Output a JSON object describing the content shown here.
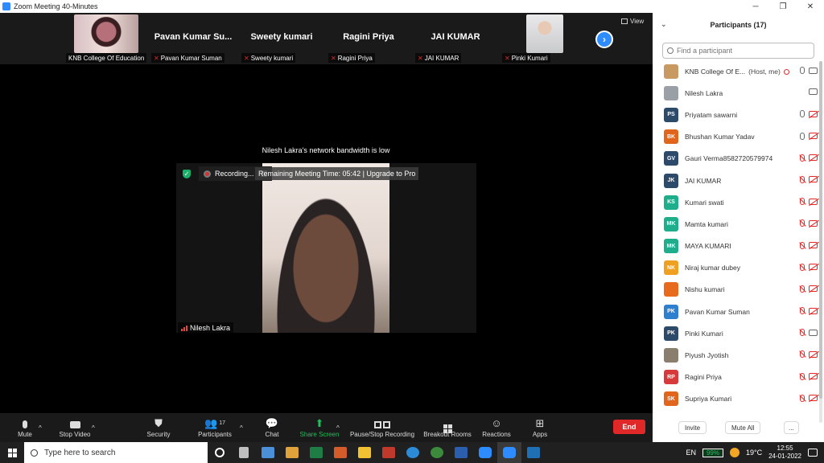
{
  "window": {
    "title": "Zoom Meeting 40-Minutes",
    "minimize": "─",
    "maximize": "❐",
    "close": "✕"
  },
  "thumbnails": [
    {
      "label": "KNB College Of Education",
      "big_name": "",
      "muted": false,
      "photo": "woman-red"
    },
    {
      "label": "Pavan Kumar Suman",
      "big_name": "Pavan Kumar Su...",
      "muted": true
    },
    {
      "label": "Sweety kumari",
      "big_name": "Sweety kumari",
      "muted": true
    },
    {
      "label": "Ragini  Priya",
      "big_name": "Ragini  Priya",
      "muted": true
    },
    {
      "label": "JAI KUMAR",
      "big_name": "JAI KUMAR",
      "muted": true
    },
    {
      "label": "Pinki Kumari",
      "big_name": "",
      "muted": true,
      "photo": "woman-white"
    }
  ],
  "view_label": "View",
  "next_arrow": "›",
  "bandwidth_notice": "Nilesh Lakra's network bandwidth is low",
  "active_video": {
    "recording_label": "Recording...",
    "remaining_text": "Remaining Meeting Time: 05:42 | Upgrade to Pro",
    "name": "Nilesh Lakra"
  },
  "toolbar": {
    "mute": "Mute",
    "stop_video": "Stop Video",
    "security": "Security",
    "participants": "Participants",
    "participants_count": "17",
    "chat": "Chat",
    "share_screen": "Share Screen",
    "recording": "Pause/Stop Recording",
    "breakout": "Breakout Rooms",
    "reactions": "Reactions",
    "apps": "Apps",
    "end": "End",
    "caret": "^"
  },
  "panel": {
    "title": "Participants (17)",
    "search_placeholder": "Find a participant",
    "invite": "Invite",
    "mute_all": "Mute All",
    "more": "...",
    "participants": [
      {
        "name": "KNB College Of E...",
        "suffix": "(Host, me)",
        "initials": "",
        "color": "#c89a62",
        "mic_muted": false,
        "cam_muted": false,
        "recording": true
      },
      {
        "name": "Nilesh Lakra",
        "initials": "",
        "color": "#9aa0a6",
        "mic_muted": null,
        "cam_muted": false
      },
      {
        "name": "Priyatam sawarni",
        "initials": "PS",
        "color": "#2d4a6b",
        "mic_muted": false,
        "cam_muted": true
      },
      {
        "name": "Bhushan Kumar Yadav",
        "initials": "BK",
        "color": "#e0651d",
        "mic_muted": false,
        "cam_muted": true
      },
      {
        "name": "Gauri Verma8582720579974",
        "initials": "GV",
        "color": "#2d4a6b",
        "mic_muted": true,
        "cam_muted": true
      },
      {
        "name": "JAI KUMAR",
        "initials": "JK",
        "color": "#2d4a6b",
        "mic_muted": true,
        "cam_muted": true
      },
      {
        "name": "Kumari swati",
        "initials": "KS",
        "color": "#1fae8c",
        "mic_muted": true,
        "cam_muted": true
      },
      {
        "name": "Mamta kumari",
        "initials": "MK",
        "color": "#1fae8c",
        "mic_muted": true,
        "cam_muted": true
      },
      {
        "name": "MAYA KUMARI",
        "initials": "MK",
        "color": "#1fae8c",
        "mic_muted": true,
        "cam_muted": true
      },
      {
        "name": "Niraj kumar dubey",
        "initials": "NK",
        "color": "#f0a020",
        "mic_muted": true,
        "cam_muted": true
      },
      {
        "name": "Nishu kumari",
        "initials": "",
        "color": "#e86a1c",
        "mic_muted": true,
        "cam_muted": true
      },
      {
        "name": "Pavan Kumar Suman",
        "initials": "PK",
        "color": "#2f7fcf",
        "mic_muted": true,
        "cam_muted": true
      },
      {
        "name": "Pinki Kumari",
        "initials": "PK",
        "color": "#2d4a6b",
        "mic_muted": true,
        "cam_muted": false
      },
      {
        "name": "Piyush Jyotish",
        "initials": "",
        "color": "#8a7e6e",
        "mic_muted": true,
        "cam_muted": true
      },
      {
        "name": "Ragini  Priya",
        "initials": "RP",
        "color": "#d63a3a",
        "mic_muted": true,
        "cam_muted": true
      },
      {
        "name": "Supriya Kumari",
        "initials": "SK",
        "color": "#e0651d",
        "mic_muted": true,
        "cam_muted": true
      }
    ]
  },
  "taskbar": {
    "search_placeholder": "Type here to search",
    "language": "EN",
    "battery": "99%",
    "temperature": "19°C",
    "time": "12:55",
    "date": "24-01-2022"
  },
  "colors": {
    "accent": "#2d8cff",
    "end": "#e02828",
    "share": "#1fbf5a"
  }
}
